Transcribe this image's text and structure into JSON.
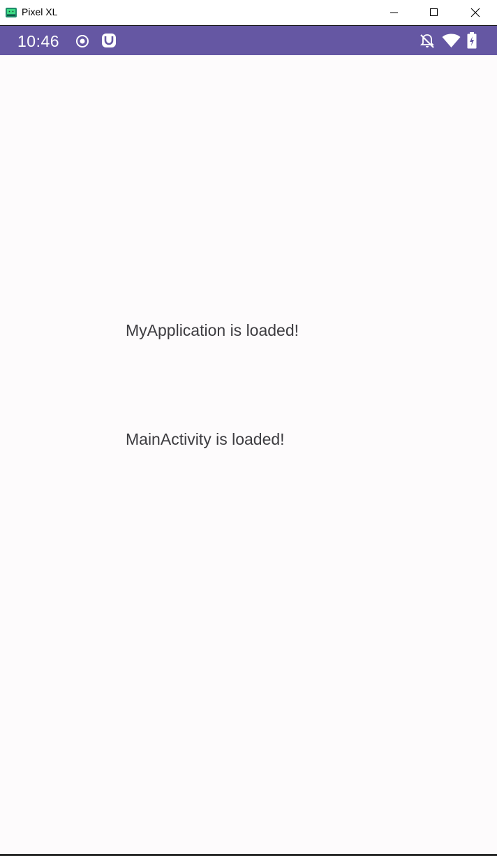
{
  "window": {
    "title": "Pixel XL",
    "icon": "android-emulator-icon"
  },
  "window_controls": {
    "minimize_icon": "minimize-icon",
    "maximize_icon": "maximize-icon",
    "close_icon": "close-icon"
  },
  "status_bar": {
    "time": "10:46",
    "color": "#6557a3",
    "left_icons": [
      "record-icon",
      "app-notification-icon"
    ],
    "right_icons": [
      "notifications-off-icon",
      "wifi-icon",
      "battery-charging-icon"
    ]
  },
  "content": {
    "messages": [
      "MyApplication is loaded!",
      "MainActivity is loaded!"
    ]
  }
}
